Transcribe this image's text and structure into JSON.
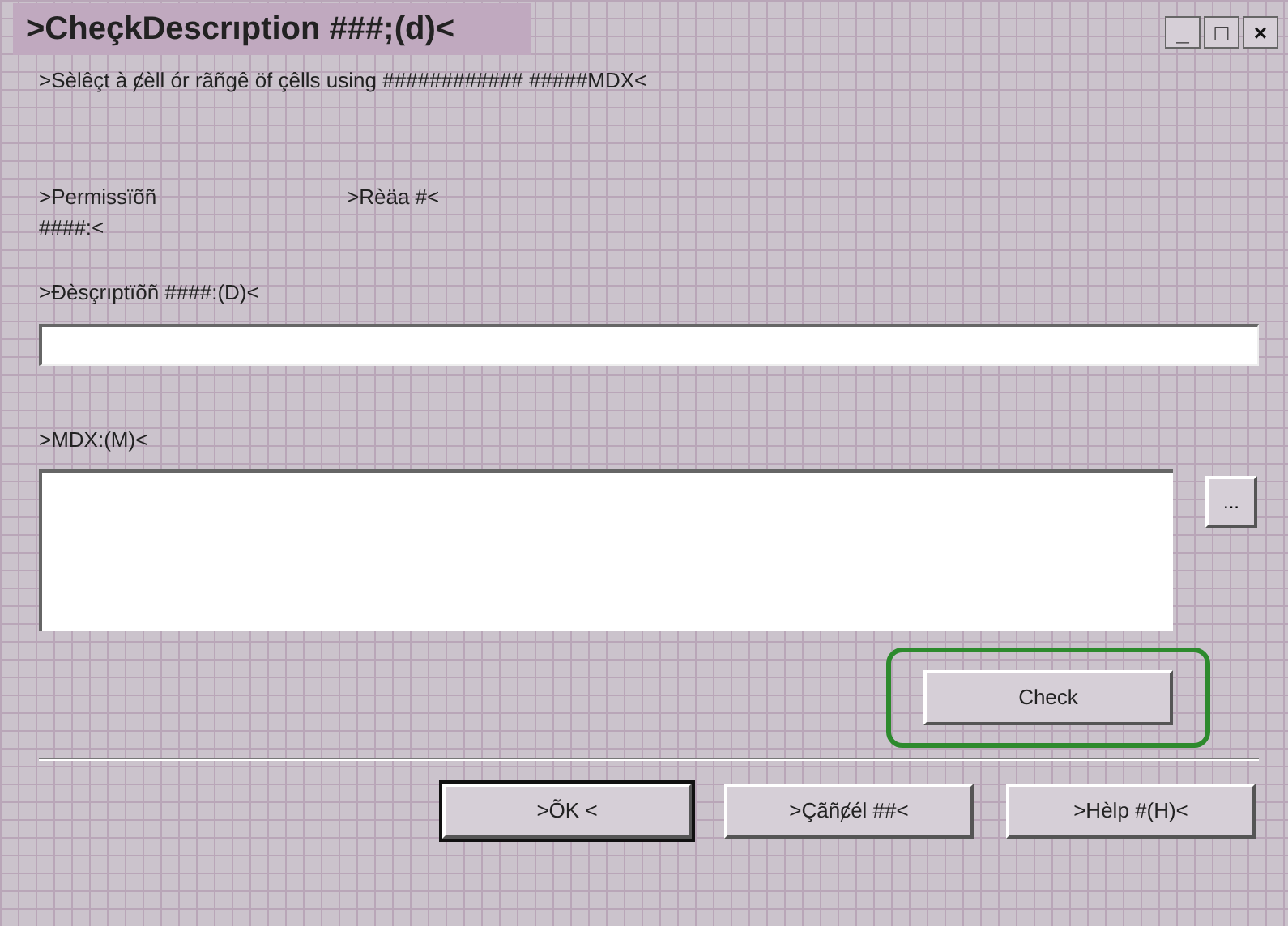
{
  "window": {
    "title": ">CheçkDescrıption ###;(d)<",
    "controls": [
      "_",
      "□",
      "×"
    ]
  },
  "instruction": ">Sèlêçt à ȼèll ór rãñgê öf çêlls using  ############ #####MDX<",
  "permission": {
    "label": ">Permissïõñ",
    "label_2": "####:<",
    "value": ">Rèäa #<"
  },
  "description": {
    "label": ">Ðèsçrıptïõñ ####:(D)<"
  },
  "mdx": {
    "label": ">MDX:(M)<",
    "browse": "..."
  },
  "check_button": {
    "label": "Check",
    "highlighted": true
  },
  "buttons": [
    {
      "label": ">ÕK <",
      "default": true
    },
    {
      "label": ">Çãñȼél ##<",
      "default": false
    },
    {
      "label": ">Hèlp #(H)<",
      "default": false
    }
  ]
}
